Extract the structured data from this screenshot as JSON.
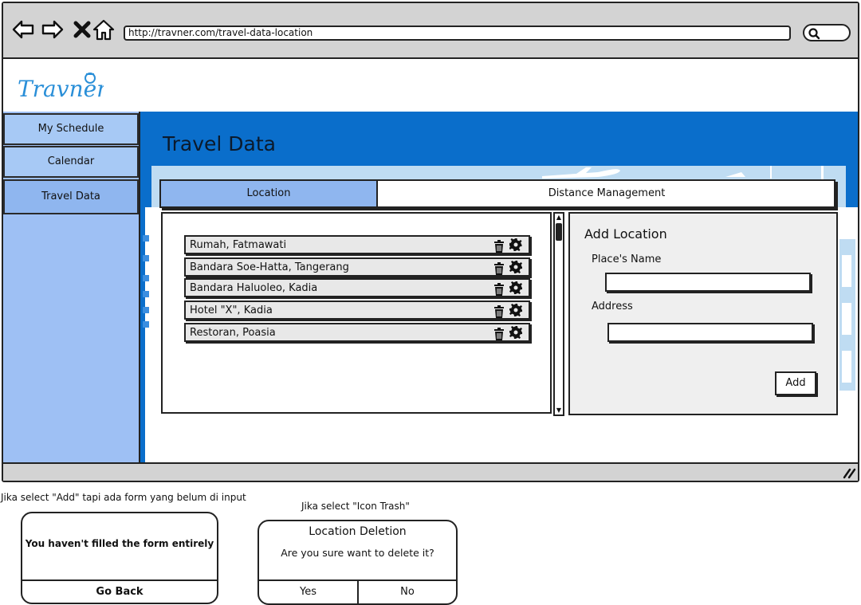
{
  "browser": {
    "url": "http://travner.com/travel-data-location"
  },
  "app": {
    "logo_text": "Travner"
  },
  "sidebar": {
    "items": [
      {
        "label": "My Schedule"
      },
      {
        "label": "Calendar"
      },
      {
        "label": "Travel Data"
      }
    ],
    "active": "Travel Data"
  },
  "page": {
    "title": "Travel Data",
    "tabs": [
      {
        "label": "Location"
      },
      {
        "label": "Distance Management"
      }
    ],
    "active_tab": "Location"
  },
  "locations": [
    {
      "name": "Rumah, Fatmawati"
    },
    {
      "name": "Bandara Soe-Hatta, Tangerang"
    },
    {
      "name": "Bandara Haluoleo, Kadia"
    },
    {
      "name": "Hotel \"X\", Kadia"
    },
    {
      "name": "Restoran, Poasia"
    }
  ],
  "form": {
    "title": "Add Location",
    "place_label": "Place's Name",
    "place_value": "",
    "address_label": "Address",
    "address_value": "",
    "submit_label": "Add"
  },
  "notes": {
    "incomplete_form": "Jika select \"Add\" tapi ada form yang belum di input",
    "trash_select": "Jika select \"Icon Trash\""
  },
  "dialogs": {
    "incomplete": {
      "message": "You haven't filled the form entirely",
      "button": "Go Back"
    },
    "deletion": {
      "title": "Location Deletion",
      "message": "Are you sure want to delete it?",
      "yes": "Yes",
      "no": "No"
    }
  },
  "colors": {
    "brand_blue": "#0a6ecb",
    "sidebar": "#9ec0f4",
    "active_tab": "#8fb6ef",
    "chrome": "#d3d3d3"
  }
}
